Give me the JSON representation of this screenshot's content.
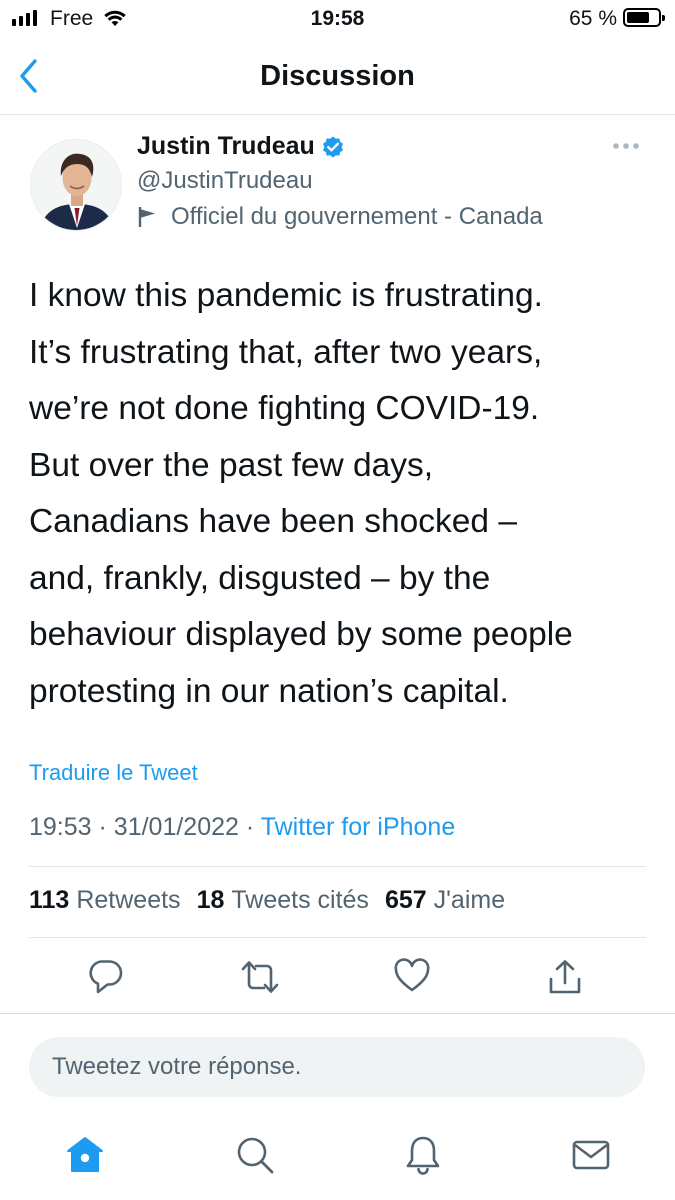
{
  "status_bar": {
    "carrier": "Free",
    "time": "19:58",
    "battery": "65 %",
    "battery_level": 0.65
  },
  "header": {
    "title": "Discussion",
    "back_icon": "chevron-left-icon"
  },
  "tweet": {
    "author_name": "Justin Trudeau",
    "handle": "@JustinTrudeau",
    "affiliation": "Officiel du gouvernement - Canada",
    "text_lines": [
      "I know this pandemic is frustrating.",
      "It’s frustrating that, after two years,",
      "we’re not done fighting COVID-19.",
      "But over the past few days,",
      "Canadians have been shocked –",
      "and, frankly, disgusted – by the",
      "behaviour displayed by some people",
      "protesting in our nation’s capital."
    ],
    "translate_label": "Traduire le Tweet",
    "time": "19:53",
    "date": "31/01/2022",
    "separator": "·",
    "source": "Twitter for iPhone"
  },
  "stats": {
    "retweets_count": "113",
    "retweets_label": "Retweets",
    "quotes_count": "18",
    "quotes_label": "Tweets cités",
    "likes_count": "657",
    "likes_label": "J'aime"
  },
  "reply": {
    "placeholder": "Tweetez votre réponse."
  },
  "colors": {
    "accent": "#1d9bf0",
    "secondary_text": "#536471",
    "divider": "#e1e8ed"
  },
  "icons": [
    "reply-icon",
    "retweet-icon",
    "like-icon",
    "share-icon",
    "home-icon",
    "search-icon",
    "notifications-icon",
    "messages-icon"
  ]
}
